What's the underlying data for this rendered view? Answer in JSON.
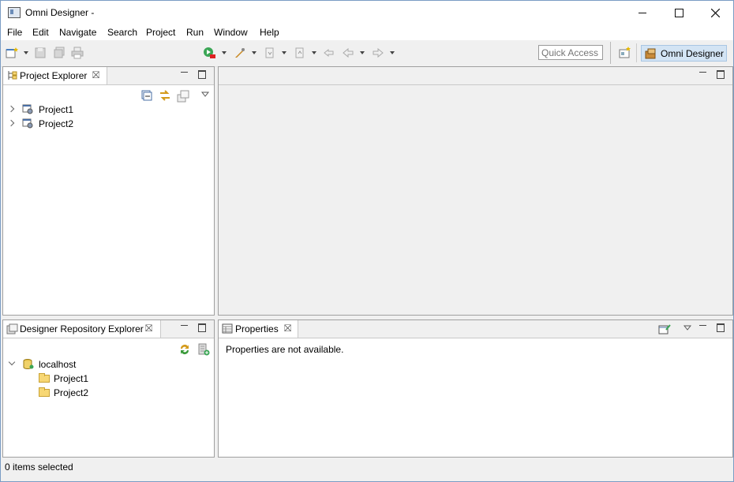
{
  "window": {
    "title": "Omni Designer -"
  },
  "menu": [
    "File",
    "Edit",
    "Navigate",
    "Search",
    "Project",
    "Run",
    "Window",
    "Help"
  ],
  "toolbar": {
    "quick_access_placeholder": "Quick Access",
    "perspective_label": "Omni Designer"
  },
  "project_explorer": {
    "tab_label": "Project Explorer",
    "items": [
      "Project1",
      "Project2"
    ]
  },
  "repo_explorer": {
    "tab_label": "Designer Repository Explorer",
    "host": "localhost",
    "items": [
      "Project1",
      "Project2"
    ]
  },
  "properties": {
    "tab_label": "Properties",
    "message": "Properties are not available."
  },
  "status_bar": {
    "text": "0 items selected"
  },
  "colors": {
    "accent": "#d3e4f4",
    "folder": "#f7d774",
    "border": "#a0a0a0"
  }
}
